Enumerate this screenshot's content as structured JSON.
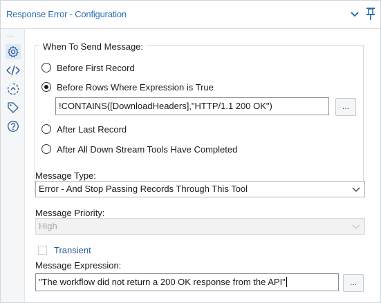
{
  "header": {
    "title": "Response Error - Configuration",
    "chevron_icon": "chevron-down-icon",
    "pin_icon": "pin-icon"
  },
  "rail": {
    "overflow_label": "...",
    "items": [
      {
        "icon": "gear-icon",
        "active": true
      },
      {
        "icon": "code-icon",
        "active": false
      },
      {
        "icon": "workflow-icon",
        "active": false
      },
      {
        "icon": "tag-icon",
        "active": false
      },
      {
        "icon": "help-icon",
        "active": false
      }
    ]
  },
  "when_to_send": {
    "legend": "When To Send Message:",
    "options": [
      {
        "label": "Before First Record",
        "checked": false
      },
      {
        "label": "Before Rows Where Expression is True",
        "checked": true
      },
      {
        "label": "After Last Record",
        "checked": false
      },
      {
        "label": "After All Down Stream Tools Have Completed",
        "checked": false
      }
    ],
    "expression_value": "!CONTAINS([DownloadHeaders],\"HTTP/1.1 200 OK\")",
    "expression_button_label": "..."
  },
  "message_type": {
    "label": "Message Type:",
    "selected": "Error - And Stop Passing Records Through This Tool"
  },
  "message_priority": {
    "label": "Message Priority:",
    "selected": "High",
    "disabled": true
  },
  "transient": {
    "label": "Transient",
    "checked": false
  },
  "message_expression": {
    "label": "Message Expression:",
    "value": "\"The workflow did not return a 200 OK response from the API\"",
    "button_label": "..."
  },
  "colors": {
    "accent": "#2a6fb5",
    "rail_bg": "#f4f6f8",
    "active_rail": "#dfe9f5"
  }
}
